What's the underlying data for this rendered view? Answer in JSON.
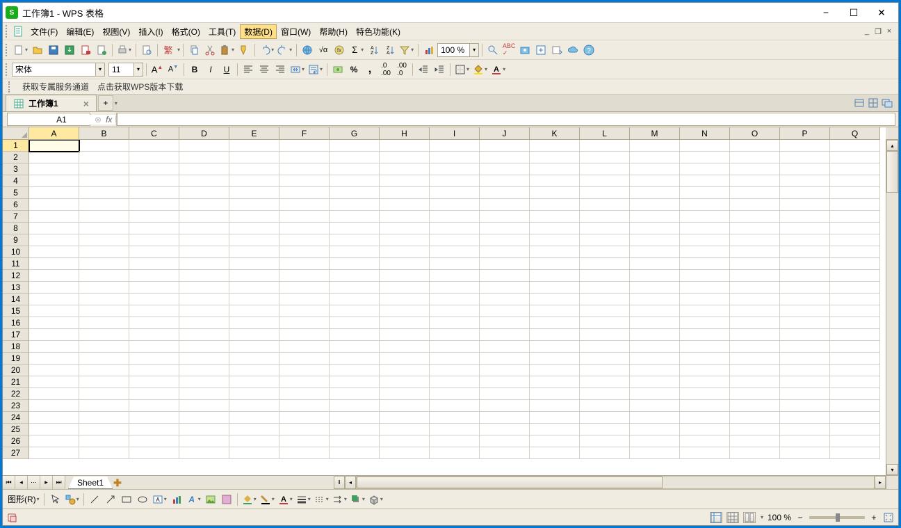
{
  "app": {
    "icon_letter": "S",
    "title": "工作簿1 - WPS 表格"
  },
  "menus": {
    "file": "文件(F)",
    "edit": "编辑(E)",
    "view": "视图(V)",
    "insert": "插入(I)",
    "format": "格式(O)",
    "tools": "工具(T)",
    "data": "数据(D)",
    "window": "窗口(W)",
    "help": "帮助(H)",
    "special": "特色功能(K)"
  },
  "active_menu": "data",
  "toolbar1": {
    "zoom": "100 %",
    "trad": "繁"
  },
  "format_bar": {
    "font": "宋体",
    "size": "11"
  },
  "info": {
    "channel": "获取专属服务通道",
    "download": "点击获取WPS版本下载"
  },
  "workbook_tab": {
    "name": "工作簿1"
  },
  "cell_ref": {
    "value": "A1"
  },
  "fx_label": "fx",
  "columns": [
    "A",
    "B",
    "C",
    "D",
    "E",
    "F",
    "G",
    "H",
    "I",
    "J",
    "K",
    "L",
    "M",
    "N",
    "O",
    "P",
    "Q"
  ],
  "rows": [
    1,
    2,
    3,
    4,
    5,
    6,
    7,
    8,
    9,
    10,
    11,
    12,
    13,
    14,
    15,
    16,
    17,
    18,
    19,
    20,
    21,
    22,
    23,
    24,
    25,
    26,
    27
  ],
  "active_cell": {
    "col": "A",
    "row": 1
  },
  "sheet": {
    "name": "Sheet1"
  },
  "drawing": {
    "label": "图形(R)"
  },
  "status": {
    "zoom": "100 %"
  }
}
